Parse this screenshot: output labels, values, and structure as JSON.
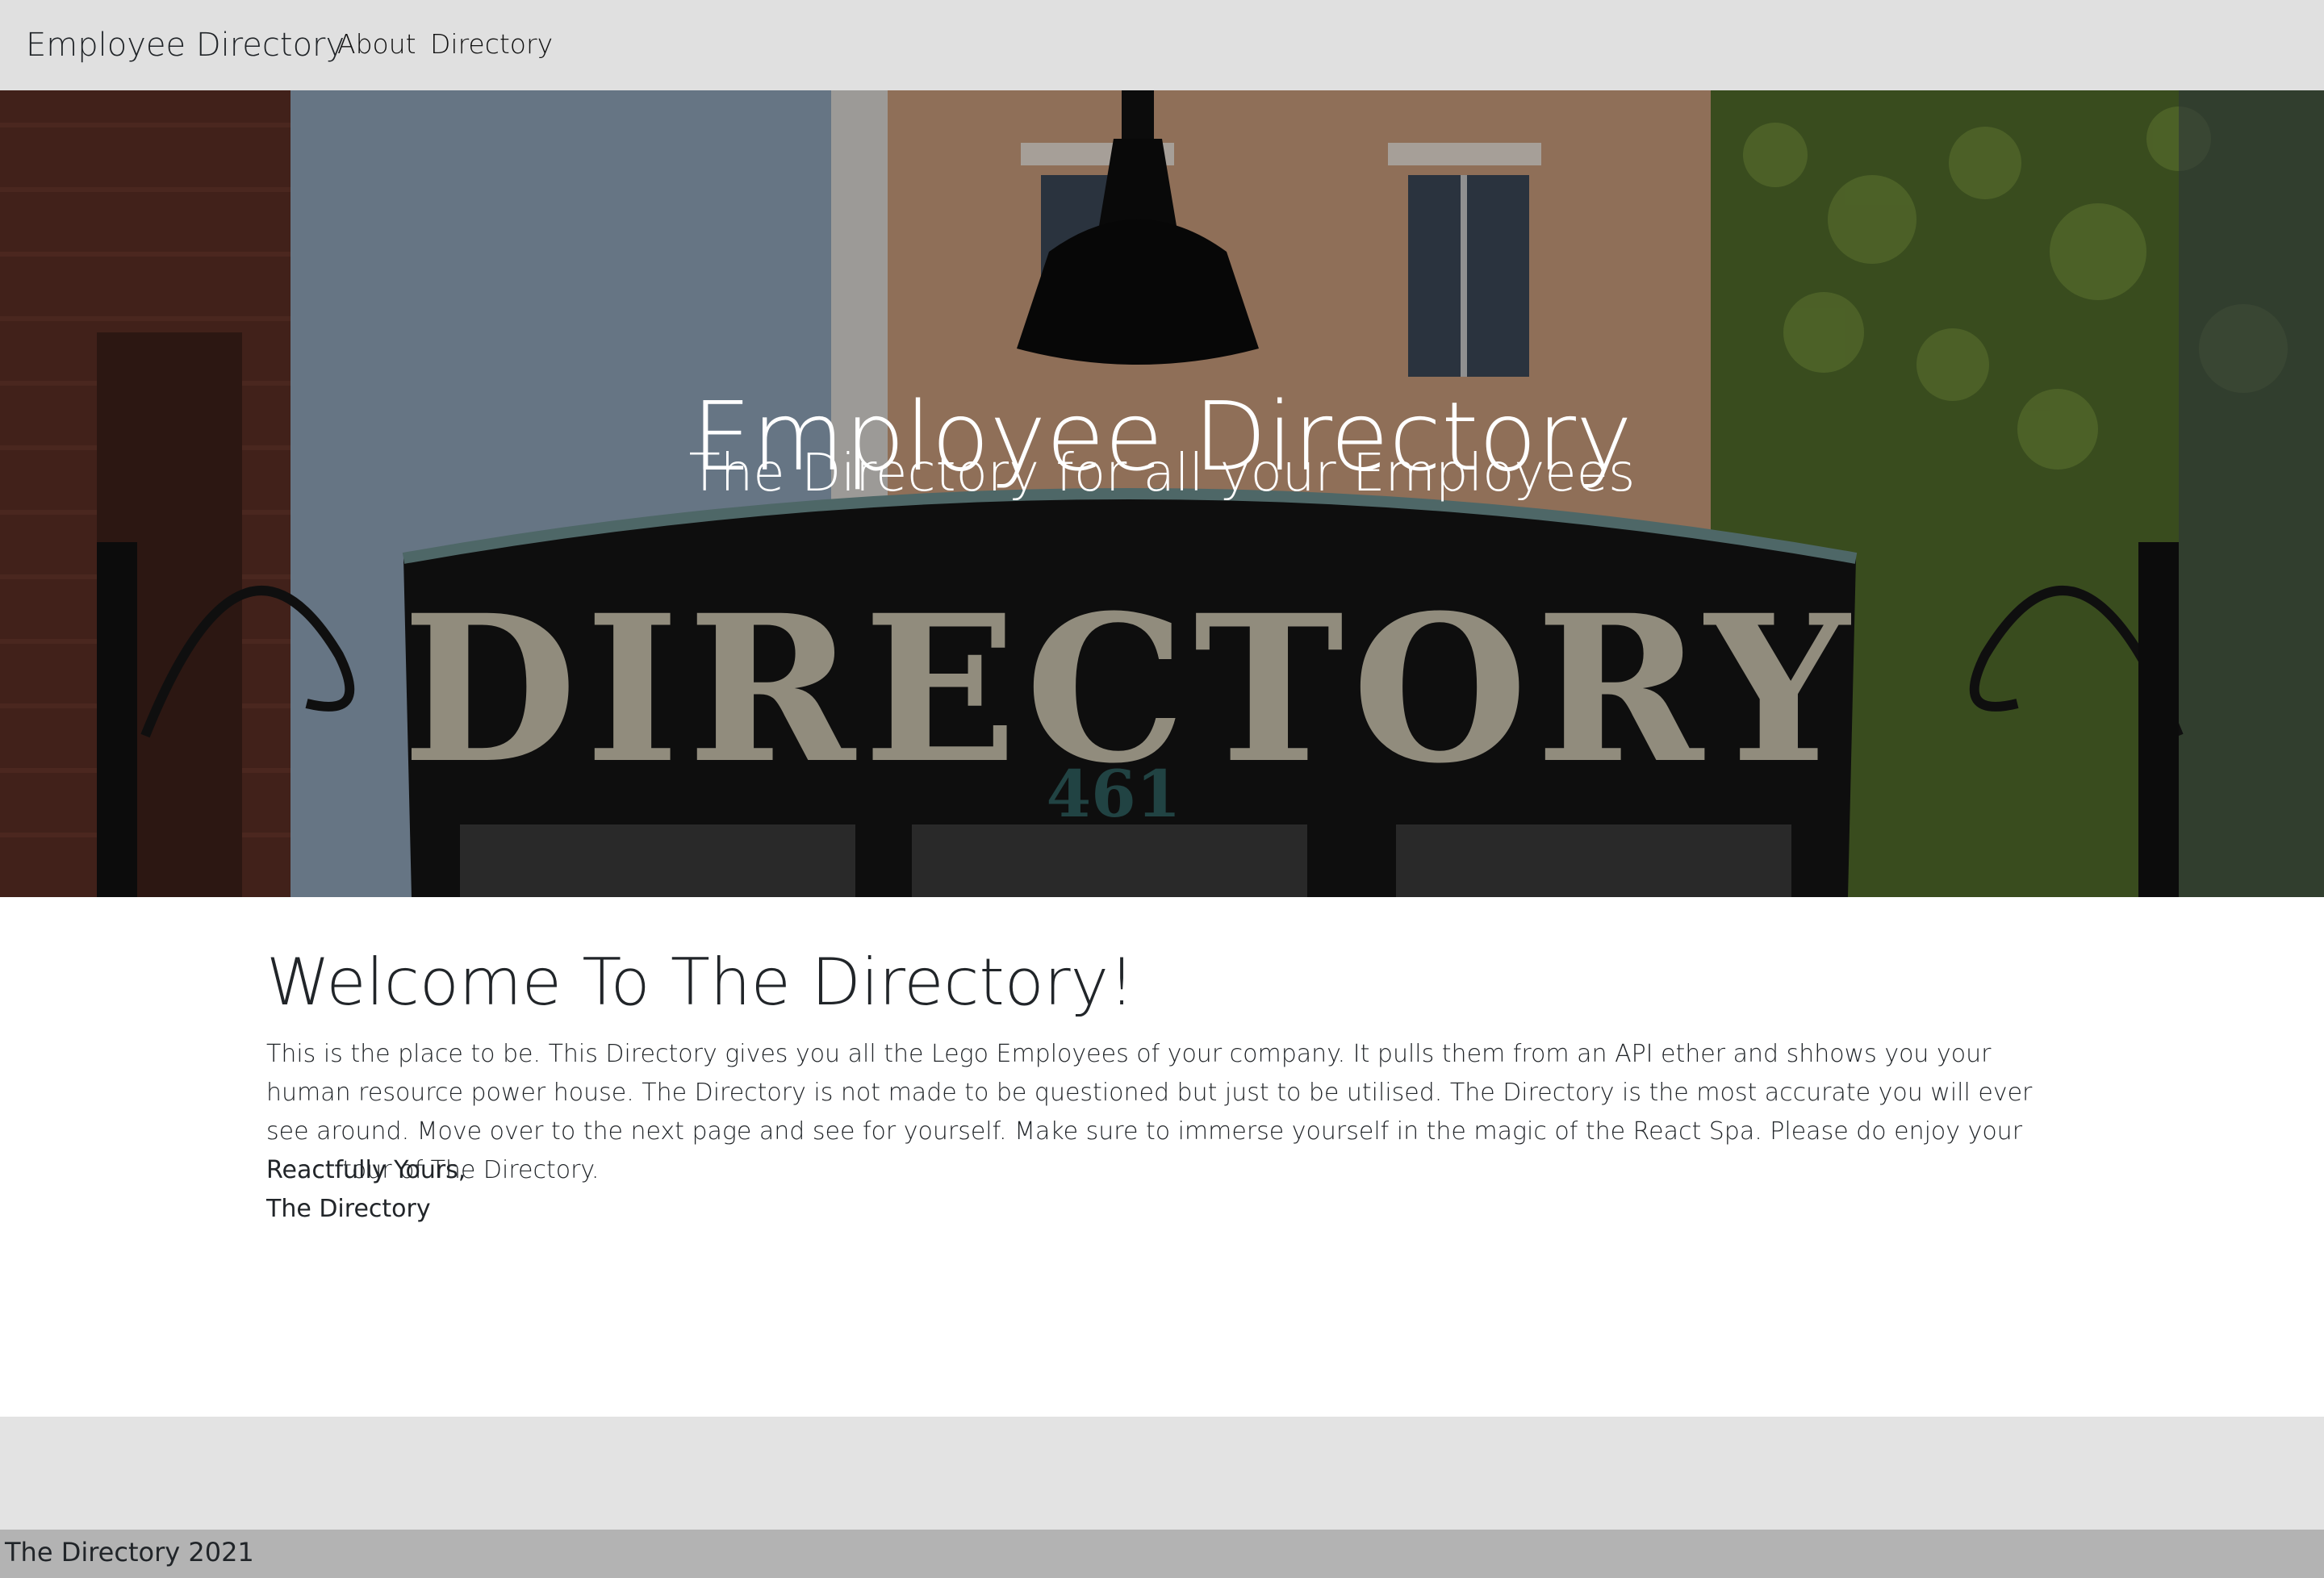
{
  "navbar": {
    "brand": "Employee Directory",
    "links": [
      {
        "label": "About"
      },
      {
        "label": "Directory"
      }
    ]
  },
  "hero": {
    "title": "Employee Directory",
    "subtitle": "The Directory for all your Employees",
    "image_sign_text": "DIRECTORY",
    "image_sign_number": "461"
  },
  "main": {
    "welcome_title": "Welcome To The Directory!",
    "body": "This is the place to be. This Directory gives you all the Lego Employees of your company. It pulls them from an API ether and shhows you your human resource power house. The Directory is not made to be questioned but just to be utilised. The Directory is the most accurate you will ever see around. Move over to the next page and see for yourself. Make sure to immerse yourself in the magic of the React Spa. Please do enjoy your React tour of The Directory.",
    "signoff_line1": "Reactfully Yours,",
    "signoff_line2": "The Directory"
  },
  "footer": {
    "text": "The Directory 2021"
  },
  "colors": {
    "navbar_bg": "#e0e0e0",
    "footer_band_bg": "#e3e3e3",
    "footer_bar_bg": "#b3b3b3",
    "text": "#212529",
    "hero_text": "#ffffff"
  }
}
